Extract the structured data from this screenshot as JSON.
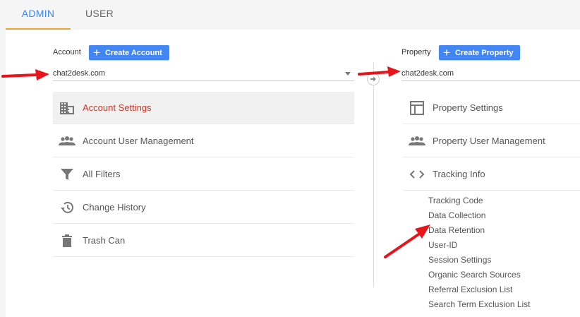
{
  "tabs": {
    "admin": "ADMIN",
    "user": "USER"
  },
  "account": {
    "label": "Account",
    "create_button": "Create Account",
    "selected": "chat2desk.com",
    "menu": [
      {
        "label": "Account Settings",
        "icon": "building-icon",
        "active": true
      },
      {
        "label": "Account User Management",
        "icon": "people-icon"
      },
      {
        "label": "All Filters",
        "icon": "filter-icon"
      },
      {
        "label": "Change History",
        "icon": "history-icon"
      },
      {
        "label": "Trash Can",
        "icon": "trash-icon"
      }
    ]
  },
  "property": {
    "label": "Property",
    "create_button": "Create Property",
    "selected": "chat2desk.com",
    "menu": [
      {
        "label": "Property Settings",
        "icon": "layout-icon"
      },
      {
        "label": "Property User Management",
        "icon": "people-icon"
      },
      {
        "label": "Tracking Info",
        "icon": "code-icon"
      }
    ],
    "tracking_submenu": [
      "Tracking Code",
      "Data Collection",
      "Data Retention",
      "User-ID",
      "Session Settings",
      "Organic Search Sources",
      "Referral Exclusion List",
      "Search Term Exclusion List"
    ]
  },
  "colors": {
    "accent": "#4285f4",
    "tab_underline": "#f0a330",
    "active_text": "#c0392b",
    "annotation": "#e8141c"
  }
}
